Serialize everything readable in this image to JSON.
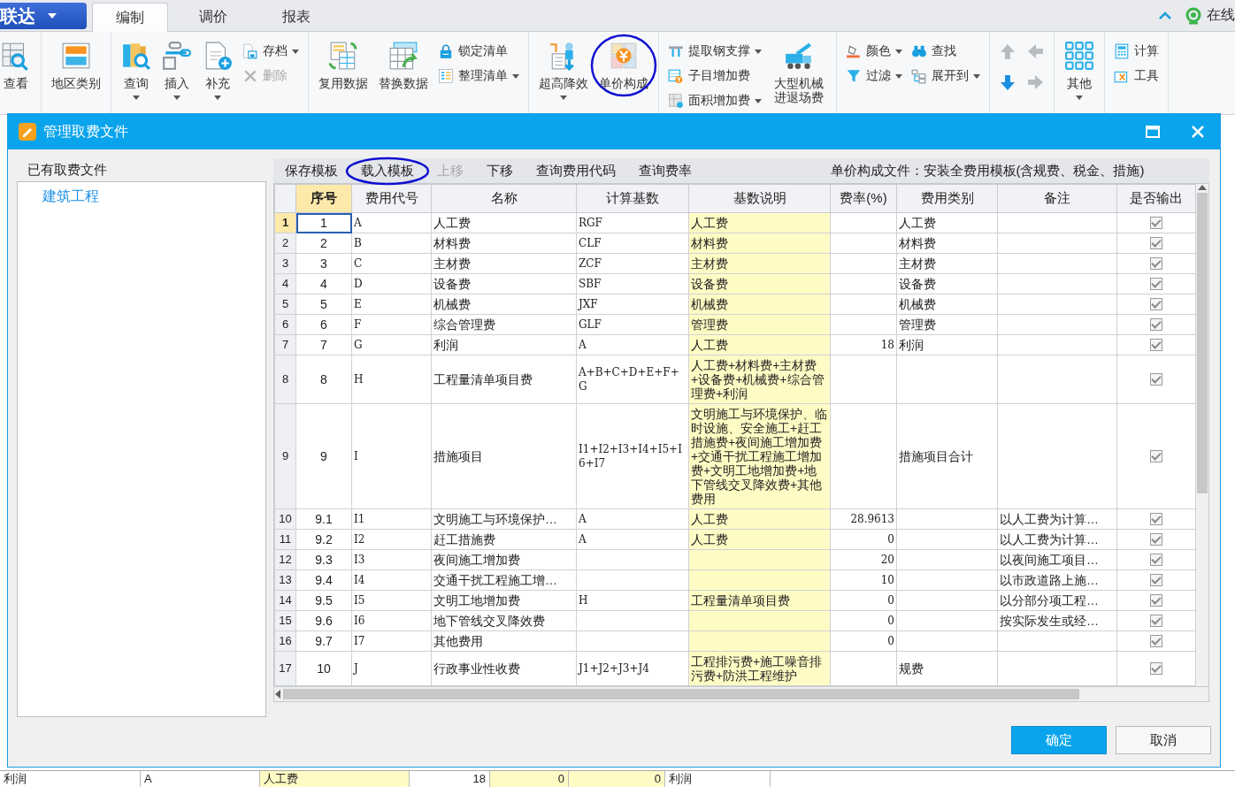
{
  "ribbon": {
    "app_button": "联达",
    "tabs": [
      {
        "label": "编制",
        "selected": true
      },
      {
        "label": "调价",
        "selected": false
      },
      {
        "label": "报表",
        "selected": false
      }
    ],
    "help": "在线",
    "groups": [
      {
        "items": [
          {
            "kind": "large",
            "label": "查看"
          }
        ]
      },
      {
        "items": [
          {
            "kind": "large",
            "label": "地区类别"
          }
        ]
      },
      {
        "items": [
          {
            "kind": "large",
            "label": "查询",
            "dropdown": true
          },
          {
            "kind": "large",
            "label": "插入",
            "dropdown": true
          },
          {
            "kind": "large",
            "label": "补充",
            "dropdown": true
          },
          {
            "kind": "stack",
            "items": [
              {
                "label": "存档",
                "dropdown": true,
                "disabled": false
              },
              {
                "label": "删除",
                "dropdown": false,
                "disabled": true
              }
            ]
          }
        ]
      },
      {
        "items": [
          {
            "kind": "large",
            "label": "复用数据"
          },
          {
            "kind": "large",
            "label": "替换数据"
          },
          {
            "kind": "stack",
            "items": [
              {
                "label": "锁定清单",
                "dropdown": false,
                "disabled": false
              },
              {
                "label": "整理清单",
                "dropdown": true,
                "disabled": false
              }
            ]
          }
        ]
      },
      {
        "items": [
          {
            "kind": "large",
            "label": "超高降效",
            "dropdown": true,
            "circled": false
          },
          {
            "kind": "large",
            "label": "单价构成",
            "dropdown": false,
            "circled": true
          }
        ]
      },
      {
        "items": [
          {
            "kind": "stack",
            "items": [
              {
                "label": "提取钢支撑",
                "dropdown": true,
                "disabled": false
              },
              {
                "label": "子目增加费",
                "dropdown": false,
                "disabled": false
              },
              {
                "label": "面积增加费",
                "dropdown": true,
                "disabled": false
              }
            ]
          },
          {
            "kind": "large",
            "label": "大型机械进退场费"
          }
        ]
      },
      {
        "items": [
          {
            "kind": "stack",
            "items": [
              {
                "label": "颜色",
                "dropdown": true,
                "disabled": false
              },
              {
                "label": "过滤",
                "dropdown": true,
                "disabled": false
              }
            ]
          },
          {
            "kind": "stack",
            "items": [
              {
                "label": "查找",
                "dropdown": false,
                "disabled": false
              },
              {
                "label": "展开到",
                "dropdown": true,
                "disabled": false
              }
            ]
          }
        ]
      },
      {
        "items": [
          {
            "kind": "arrows",
            "items": [
              {
                "disabled": true
              },
              {
                "disabled": true
              },
              {
                "disabled": false
              },
              {
                "disabled": true
              }
            ]
          }
        ]
      },
      {
        "items": [
          {
            "kind": "large",
            "label": "其他",
            "dropdown": true
          }
        ]
      },
      {
        "items": [
          {
            "kind": "stack",
            "items": [
              {
                "label": "计算",
                "dropdown": false,
                "disabled": false
              },
              {
                "label": "工具",
                "dropdown": false,
                "disabled": false
              }
            ]
          }
        ]
      }
    ]
  },
  "dialog": {
    "title": "管理取费文件",
    "files_label": "已有取费文件",
    "files": [
      {
        "label": "建筑工程"
      }
    ],
    "toolbar": {
      "items": [
        {
          "label": "保存模板",
          "disabled": false,
          "circled": false
        },
        {
          "label": "载入模板",
          "disabled": false,
          "circled": true
        },
        {
          "label": "上移",
          "disabled": true,
          "circled": false
        },
        {
          "label": "下移",
          "disabled": false,
          "circled": false
        },
        {
          "label": "查询费用代码",
          "disabled": false,
          "circled": false
        },
        {
          "label": "查询费率",
          "disabled": false,
          "circled": false
        }
      ],
      "file_caption": "单价构成文件：安装全费用模板(含规费、税金、措施)"
    },
    "table": {
      "columns": [
        {
          "label": "序号",
          "selected": true,
          "editable": false
        },
        {
          "label": "费用代号",
          "selected": false,
          "editable": false
        },
        {
          "label": "名称",
          "selected": false,
          "editable": false
        },
        {
          "label": "计算基数",
          "selected": false,
          "editable": false
        },
        {
          "label": "基数说明",
          "selected": false,
          "editable": true
        },
        {
          "label": "费率(%)",
          "selected": false,
          "editable": false
        },
        {
          "label": "费用类别",
          "selected": false,
          "editable": false
        },
        {
          "label": "备注",
          "selected": false,
          "editable": false
        },
        {
          "label": "是否输出",
          "selected": false,
          "editable": false
        }
      ],
      "rows": [
        {
          "no": "1",
          "cells": [
            "1",
            "A",
            "人工费",
            "RGF",
            "人工费",
            "",
            "人工费",
            ""
          ],
          "output": true,
          "selected": true
        },
        {
          "no": "2",
          "cells": [
            "2",
            "B",
            "材料费",
            "CLF",
            "材料费",
            "",
            "材料费",
            ""
          ],
          "output": true,
          "selected": false
        },
        {
          "no": "3",
          "cells": [
            "3",
            "C",
            "主材费",
            "ZCF",
            "主材费",
            "",
            "主材费",
            ""
          ],
          "output": true,
          "selected": false
        },
        {
          "no": "4",
          "cells": [
            "4",
            "D",
            "设备费",
            "SBF",
            "设备费",
            "",
            "设备费",
            ""
          ],
          "output": true,
          "selected": false
        },
        {
          "no": "5",
          "cells": [
            "5",
            "E",
            "机械费",
            "JXF",
            "机械费",
            "",
            "机械费",
            ""
          ],
          "output": true,
          "selected": false
        },
        {
          "no": "6",
          "cells": [
            "6",
            "F",
            "综合管理费",
            "GLF",
            "管理费",
            "",
            "管理费",
            ""
          ],
          "output": true,
          "selected": false
        },
        {
          "no": "7",
          "cells": [
            "7",
            "G",
            "利润",
            "A",
            "人工费",
            "18",
            "利润",
            ""
          ],
          "output": true,
          "selected": false
        },
        {
          "no": "8",
          "cells": [
            "8",
            "H",
            "工程量清单项目费",
            "A+B+C+D+E+F+G",
            "人工费+材料费+主材费+设备费+机械费+综合管理费+利润",
            "",
            "",
            ""
          ],
          "output": true,
          "selected": false
        },
        {
          "no": "9",
          "cells": [
            "9",
            "I",
            "措施项目",
            "I1+I2+I3+I4+I5+I6+I7",
            "文明施工与环境保护、临时设施、安全施工+赶工措施费+夜间施工增加费+交通干扰工程施工增加费+文明工地增加费+地下管线交叉降效费+其他费用",
            "",
            "措施项目合计",
            ""
          ],
          "output": true,
          "selected": false
        },
        {
          "no": "10",
          "cells": [
            "9.1",
            "I1",
            "文明施工与环境保护…",
            "A",
            "人工费",
            "28.9613",
            "",
            "以人工费为计算…"
          ],
          "output": true,
          "selected": false
        },
        {
          "no": "11",
          "cells": [
            "9.2",
            "I2",
            "赶工措施费",
            "A",
            "人工费",
            "0",
            "",
            "以人工费为计算…"
          ],
          "output": true,
          "selected": false
        },
        {
          "no": "12",
          "cells": [
            "9.3",
            "I3",
            "夜间施工增加费",
            "",
            "",
            "20",
            "",
            "以夜间施工项目…"
          ],
          "output": true,
          "selected": false
        },
        {
          "no": "13",
          "cells": [
            "9.4",
            "I4",
            "交通干扰工程施工增…",
            "",
            "",
            "10",
            "",
            "以市政道路上施…"
          ],
          "output": true,
          "selected": false
        },
        {
          "no": "14",
          "cells": [
            "9.5",
            "I5",
            "文明工地增加费",
            "H",
            "工程量清单项目费",
            "0",
            "",
            "以分部分项工程…"
          ],
          "output": true,
          "selected": false
        },
        {
          "no": "15",
          "cells": [
            "9.6",
            "I6",
            "地下管线交叉降效费",
            "",
            "",
            "0",
            "",
            "按实际发生或经…"
          ],
          "output": true,
          "selected": false
        },
        {
          "no": "16",
          "cells": [
            "9.7",
            "I7",
            "其他费用",
            "",
            "",
            "0",
            "",
            ""
          ],
          "output": true,
          "selected": false
        },
        {
          "no": "17",
          "cells": [
            "10",
            "J",
            "行政事业性收费",
            "J1+J2+J3+J4",
            "工程排污费+施工噪音排污费+防洪工程维护",
            "",
            "规费",
            ""
          ],
          "output": true,
          "selected": false
        }
      ]
    },
    "buttons": [
      {
        "label": "确定",
        "primary": true
      },
      {
        "label": "取消",
        "primary": false
      }
    ]
  },
  "background_row": [
    "利润",
    "A",
    "人工费",
    "18",
    "0",
    "0",
    "利润"
  ]
}
